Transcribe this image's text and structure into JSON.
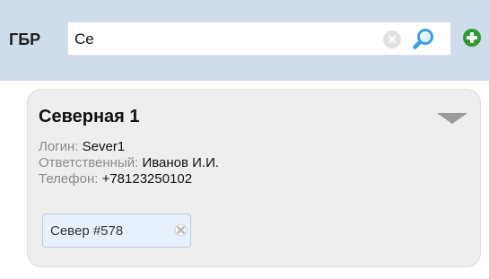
{
  "header": {
    "label": "ГБР",
    "search": {
      "value": "Се",
      "clear_icon": "clear-icon",
      "search_icon": "search-icon"
    },
    "add_icon": "add-icon"
  },
  "card": {
    "title": "Северная 1",
    "dropdown_icon": "chevron-down-icon",
    "details": [
      {
        "label": "Логин:",
        "value": "Sever1"
      },
      {
        "label": "Ответственный:",
        "value": "Иванов И.И."
      },
      {
        "label": "Телефон:",
        "value": "+78123250102"
      }
    ],
    "tag": {
      "label": "Север #578",
      "remove_icon": "remove-icon"
    }
  },
  "colors": {
    "header_background": "#cfdcea",
    "card_background": "#eeeeee",
    "tag_background": "#e8f1fb",
    "add_icon": "#2e9b2e",
    "label_text": "#8a8a8a"
  }
}
